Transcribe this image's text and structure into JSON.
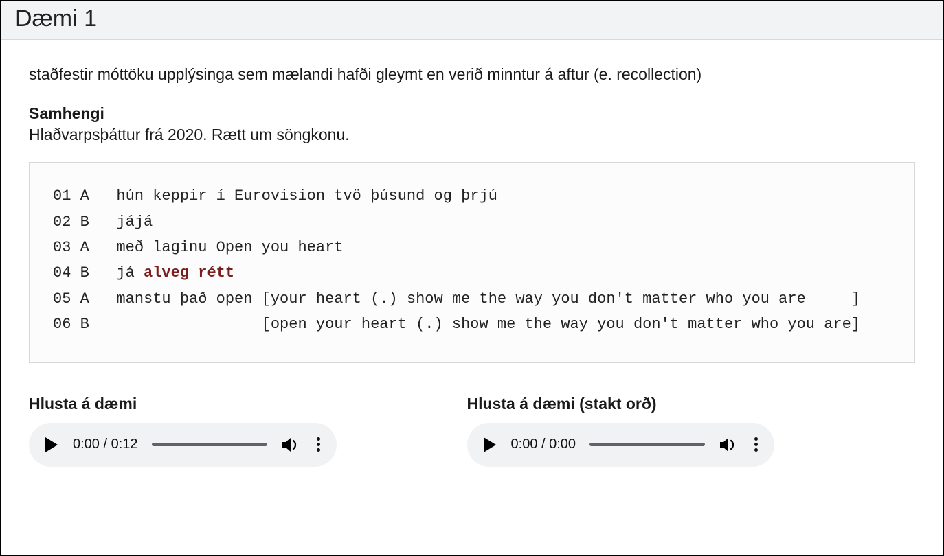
{
  "header": {
    "title": "Dæmi 1"
  },
  "description": "staðfestir móttöku upplýsinga sem mælandi hafði gleymt en verið minntur á aftur (e. recollection)",
  "context": {
    "label": "Samhengi",
    "text": "Hlaðvarpsþáttur frá 2020. Rætt um söngkonu."
  },
  "transcript": {
    "lines": [
      {
        "num": "01",
        "speaker": "A",
        "text": "hún keppir í Eurovision tvö þúsund og þrjú"
      },
      {
        "num": "02",
        "speaker": "B",
        "text": "jájá"
      },
      {
        "num": "03",
        "speaker": "A",
        "text": "með laginu Open you heart"
      },
      {
        "num": "04",
        "speaker": "B",
        "prefix": "já ",
        "highlight": "alveg rétt"
      },
      {
        "num": "05",
        "speaker": "A",
        "text": "manstu það open [your heart (.) show me the way you don't matter who you are     ]"
      },
      {
        "num": "06",
        "speaker": "B",
        "text": "                [open your heart (.) show me the way you don't matter who you are]"
      }
    ]
  },
  "audio": {
    "left": {
      "label": "Hlusta á dæmi",
      "time": "0:00 / 0:12",
      "track_width": 168
    },
    "right": {
      "label": "Hlusta á dæmi (stakt orð)",
      "time": "0:00 / 0:00",
      "track_width": 168
    }
  }
}
